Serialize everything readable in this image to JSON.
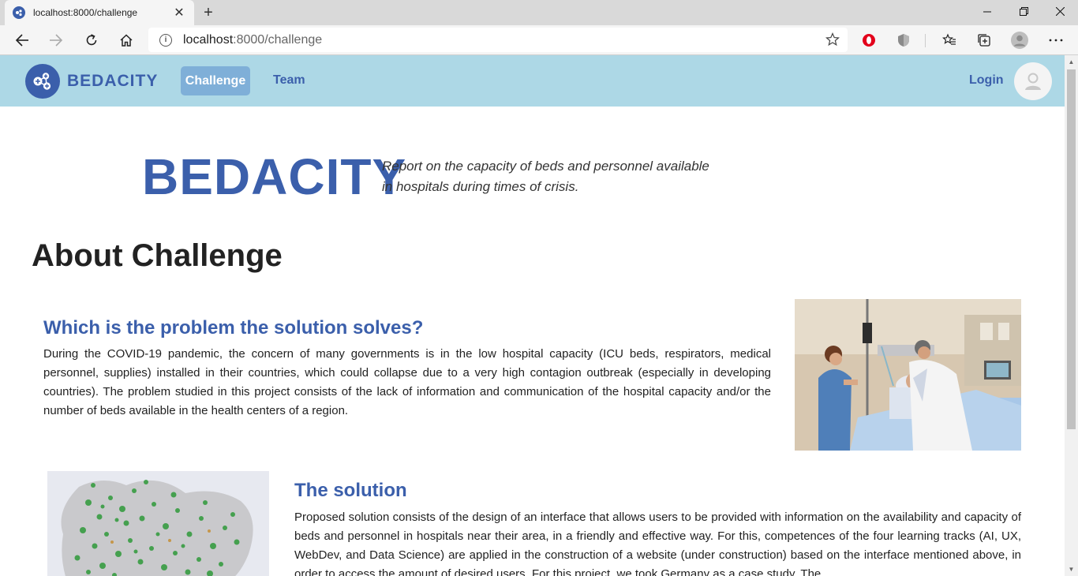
{
  "browser": {
    "tab_title": "localhost:8000/challenge",
    "url_host": "localhost",
    "url_rest": ":8000/challenge"
  },
  "nav": {
    "brand": "BEDACITY",
    "items": [
      "Challenge",
      "Team"
    ],
    "login": "Login"
  },
  "hero": {
    "title": "BEDACITY",
    "subtitle": "Report on the capacity of beds and personnel available in hospitals during times of crisis."
  },
  "about": {
    "title": "About Challenge",
    "problem_heading": "Which is the problem the solution solves?",
    "problem_text": "During the COVID-19 pandemic, the concern of many governments is in the low hospital capacity (ICU beds, respirators, medical personnel, supplies) installed in their countries, which could collapse due to a very high contagion outbreak (especially in developing countries). The problem studied in this project consists of the lack of information and communication of the hospital capacity and/or the number of beds available in the health centers of a region.",
    "solution_heading": "The solution",
    "solution_text": "Proposed solution consists of the design of an interface that allows users to be provided with information on the availability and capacity of beds and personnel in hospitals near their area, in a friendly and effective way. For this, competences of the four learning tracks (AI, UX, WebDev, and Data Science) are applied in the construction of a website (under construction) based on the interface mentioned above, in order to access the amount of desired users. For this project, we took Germany as a case study. The"
  },
  "colors": {
    "brand_blue": "#3b5fab",
    "navbar_bg": "#add8e6",
    "active_pill": "#7fafd8"
  },
  "icons": [
    "bedacity-logo-icon",
    "back-arrow-icon",
    "forward-arrow-icon",
    "refresh-icon",
    "home-icon",
    "info-icon",
    "star-icon",
    "opera-icon",
    "shield-icon",
    "favorites-icon",
    "collections-icon",
    "profile-icon",
    "more-icon",
    "user-avatar-icon"
  ]
}
